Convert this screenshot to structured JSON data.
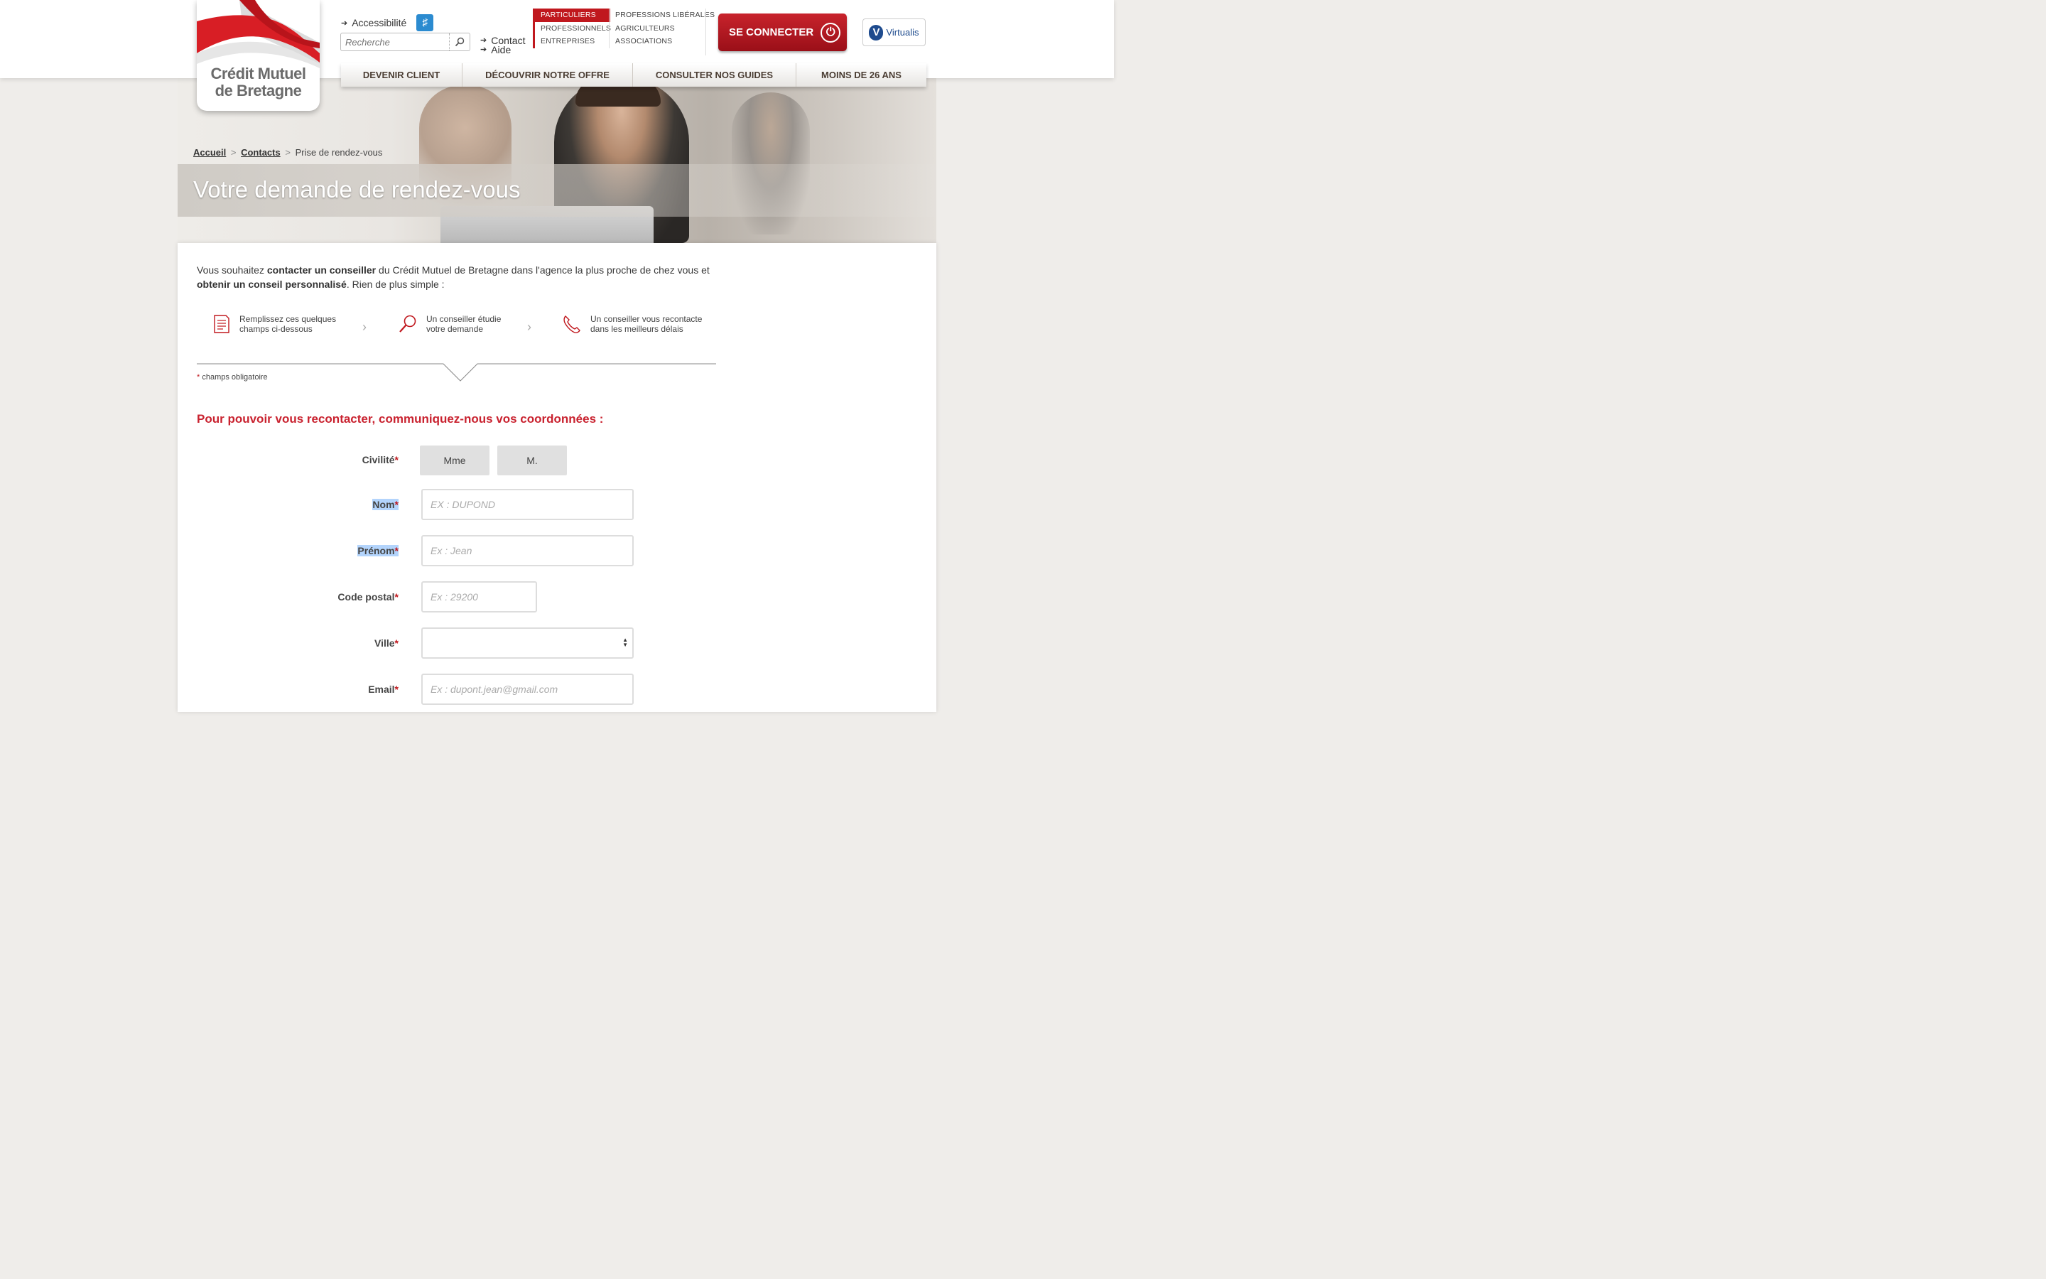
{
  "header": {
    "logo_line1": "Crédit Mutuel",
    "logo_line2": "de Bretagne",
    "accessibility_label": "Accessibilité",
    "search_placeholder": "Recherche",
    "contact_label": "Contact",
    "aide_label": "Aide",
    "segments_left": [
      "PARTICULIERS",
      "PROFESSIONNELS",
      "ENTREPRISES"
    ],
    "segments_right": [
      "PROFESSIONS LIBÉRALES",
      "AGRICULTEURS",
      "ASSOCIATIONS"
    ],
    "connect_label": "SE CONNECTER",
    "virtualis_label": "Virtualis",
    "brand_red": "#c0181e"
  },
  "nav": {
    "items": [
      "DEVENIR CLIENT",
      "DÉCOUVRIR NOTRE OFFRE",
      "CONSULTER NOS GUIDES",
      "MOINS DE 26 ANS"
    ]
  },
  "breadcrumb": {
    "home": "Accueil",
    "contacts": "Contacts",
    "current": "Prise de rendez-vous",
    "separator": ">"
  },
  "page": {
    "title": "Votre demande de rendez-vous"
  },
  "intro": {
    "part1": "Vous souhaitez ",
    "bold1": "contacter un conseiller",
    "part2": " du Crédit Mutuel de Bretagne dans l'agence la plus proche de chez vous et ",
    "bold2": "obtenir un conseil personnalisé",
    "part3": ". Rien de plus simple :"
  },
  "steps": [
    {
      "line1": "Remplissez ces quelques",
      "line2": "champs ci-dessous",
      "icon": "form-icon"
    },
    {
      "line1": "Un conseiller étudie",
      "line2": "votre demande",
      "icon": "magnifier-icon"
    },
    {
      "line1": "Un conseiller vous recontacte",
      "line2": "dans les meilleurs délais",
      "icon": "phone-icon"
    }
  ],
  "form": {
    "required_note": "champs obligatoire",
    "required_star": "*",
    "section_title": "Pour pouvoir vous recontacter, communiquez-nous vos coordonnées :",
    "civilite_label": "Civilité",
    "civilite_options": [
      "Mme",
      "M."
    ],
    "nom_label": "Nom",
    "nom_placeholder": "EX : DUPOND",
    "prenom_label": "Prénom",
    "prenom_placeholder": "Ex : Jean",
    "cp_label": "Code postal",
    "cp_placeholder": "Ex : 29200",
    "ville_label": "Ville",
    "ville_value": "",
    "email_label": "Email",
    "email_placeholder": "Ex : dupont.jean@gmail.com"
  }
}
